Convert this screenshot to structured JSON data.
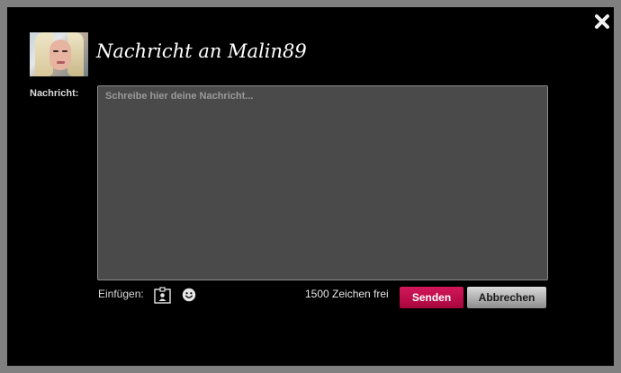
{
  "dialog": {
    "title": "Nachricht an Malin89",
    "close_icon": "close-x-icon"
  },
  "recipient": {
    "name": "Malin89",
    "avatar_icon": "profile-photo"
  },
  "form": {
    "message_label": "Nachricht:",
    "message_value": "",
    "message_placeholder": "Schreibe hier deine Nachricht..."
  },
  "toolbar": {
    "insert_label": "Einfügen:",
    "insert_icons": [
      "contact-card-icon",
      "smiley-icon"
    ],
    "chars_remaining_text": "1500 Zeichen frei",
    "send_label": "Senden",
    "cancel_label": "Abbrechen"
  },
  "colors": {
    "dialog_bg": "#000000",
    "frame_bg": "#808080",
    "send_button": "#c00f4e",
    "cancel_button": "#b5b5b5",
    "textarea_bg": "#4a4a4a"
  }
}
